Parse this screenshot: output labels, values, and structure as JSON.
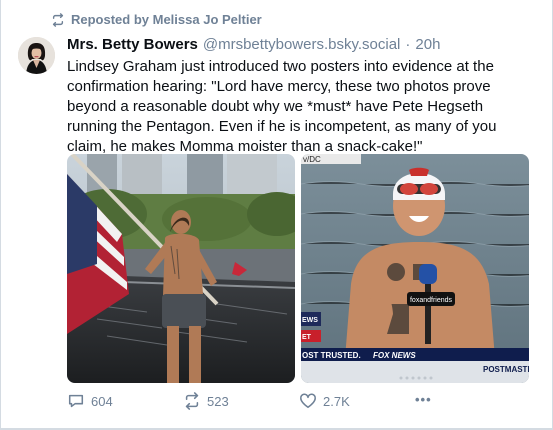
{
  "repost": {
    "label": "Reposted by Melissa Jo Peltier"
  },
  "post": {
    "author_name": "Mrs. Betty Bowers",
    "handle": "@mrsbettybowers.bsky.social",
    "separator": "·",
    "time": "20h",
    "text": "Lindsey Graham just introduced two posters into evidence at the confirmation hearing: \"Lord have mercy, these two photos prove beyond a reasonable doubt why we *must* have Pete Hegseth running the Pentagon. Even if he is incompetent, as many of you claim, he makes Momma moister than a snack-cake!\""
  },
  "images": {
    "left": {
      "icon": "memorial-photo"
    },
    "right": {
      "overlay_top": "v/DC",
      "mic_label": "foxandfriends",
      "lower_third_left": "OST TRUSTED.",
      "lower_third_logo": "FOX NEWS",
      "lower_third_right": "POSTMASTE",
      "side_tag": "EWS",
      "side_tag2": "ET"
    }
  },
  "actions": {
    "replies": "604",
    "reposts": "523",
    "likes": "2.7K",
    "more": "•••"
  }
}
